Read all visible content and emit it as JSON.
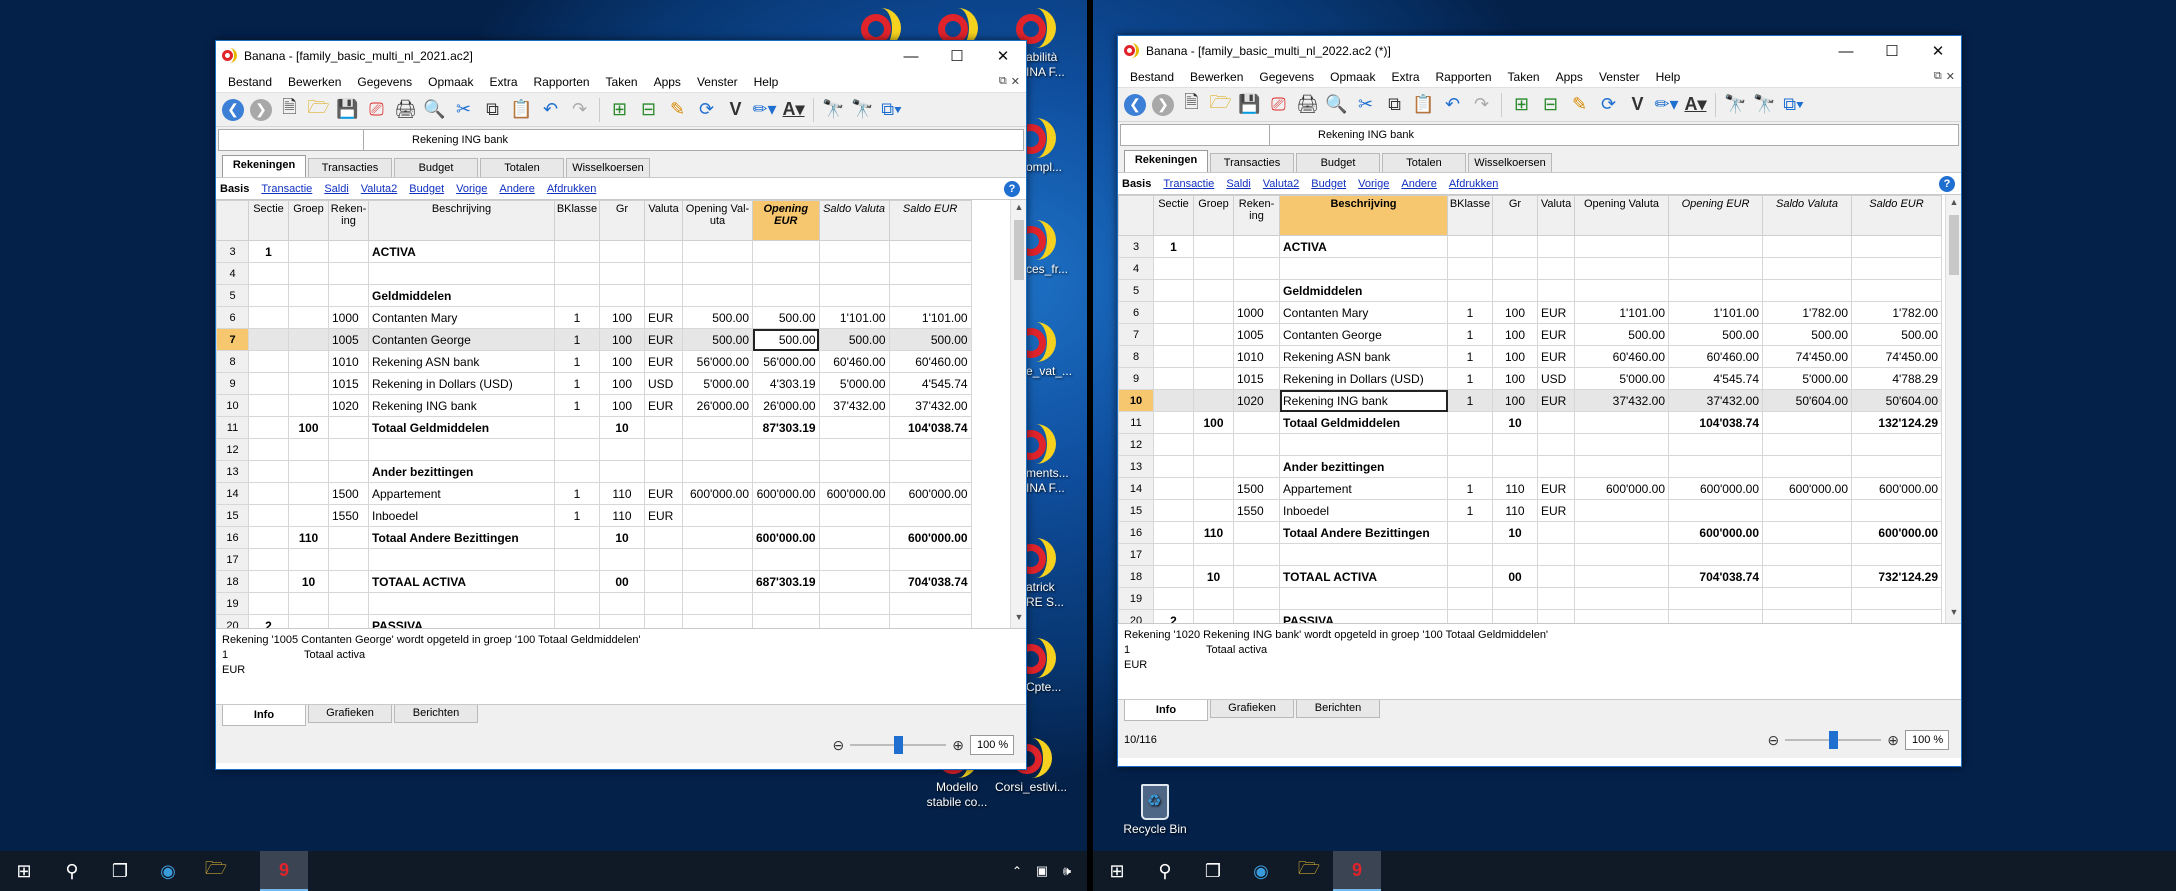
{
  "desktop": {
    "icons_left": [
      {
        "label": "abilità\nINA F...",
        "icon": "banana-icon"
      },
      {
        "label": "ompl...",
        "icon": "banana-icon"
      },
      {
        "label": "ces_fr...",
        "icon": "banana-icon"
      },
      {
        "label": "e_vat_...",
        "icon": "banana-icon"
      },
      {
        "label": "ments...\nINA F...",
        "icon": "banana-icon"
      },
      {
        "label": "atrick\nRE S...",
        "icon": "banana-icon"
      },
      {
        "label": "Cpte...",
        "icon": "banana-icon"
      },
      {
        "label": "Modello\nstabile co...",
        "icon": "banana-icon"
      },
      {
        "label": "Corsi_estivi...",
        "icon": "banana-icon"
      }
    ],
    "recycle_bin": {
      "label": "Recycle Bin",
      "icon": "recycle-bin-icon"
    }
  },
  "taskbar": {
    "icons": [
      "windows-start-icon",
      "search-icon",
      "task-view-icon",
      "edge-browser-icon",
      "file-explorer-icon",
      "banana-app-icon"
    ],
    "tray": [
      "chevron-up-icon",
      "network-icon",
      "volume-icon"
    ]
  },
  "common": {
    "menu": [
      "Bestand",
      "Bewerken",
      "Gegevens",
      "Opmaak",
      "Extra",
      "Rapporten",
      "Taken",
      "Apps",
      "Venster",
      "Help"
    ],
    "tabs": [
      "Rekeningen",
      "Transacties",
      "Budget",
      "Totalen",
      "Wisselkoersen"
    ],
    "subviews": [
      "Basis",
      "Transactie",
      "Saldi",
      "Valuta2",
      "Budget",
      "Vorige",
      "Andere",
      "Afdrukken"
    ],
    "bottom_tabs": [
      "Info",
      "Grafieken",
      "Berichten"
    ],
    "zoom": "100 %",
    "help": "?",
    "columns": [
      "",
      "Sectie",
      "Groep",
      "Rekening",
      "Beschrijving",
      "BKlasse",
      "Gr",
      "Valuta",
      "Opening Valuta",
      "Opening EUR",
      "Saldo Valuta",
      "Saldo EUR"
    ]
  },
  "win1": {
    "title": "Banana - [family_basic_multi_nl_2021.ac2]",
    "cell_value": "Rekening ING bank",
    "columns": [
      "",
      "Sectie",
      "Groep",
      "Reken-\ning",
      "Beschrijving",
      "BKlasse",
      "Gr",
      "Valuta",
      "Opening Val-\nuta",
      "Opening\nEUR",
      "Saldo Valuta",
      "Saldo EUR"
    ],
    "rows": [
      [
        "3",
        "1",
        "",
        "",
        "ACTIVA",
        "",
        "",
        "",
        "",
        "",
        "",
        ""
      ],
      [
        "4",
        "",
        "",
        "",
        "",
        "",
        "",
        "",
        "",
        "",
        "",
        ""
      ],
      [
        "5",
        "",
        "",
        "",
        "Geldmiddelen",
        "",
        "",
        "",
        "",
        "",
        "",
        ""
      ],
      [
        "6",
        "",
        "",
        "1000",
        "Contanten Mary",
        "1",
        "100",
        "EUR",
        "500.00",
        "500.00",
        "1'101.00",
        "1'101.00"
      ],
      [
        "7",
        "",
        "",
        "1005",
        "Contanten George",
        "1",
        "100",
        "EUR",
        "500.00",
        "500.00",
        "500.00",
        "500.00"
      ],
      [
        "8",
        "",
        "",
        "1010",
        "Rekening ASN bank",
        "1",
        "100",
        "EUR",
        "56'000.00",
        "56'000.00",
        "60'460.00",
        "60'460.00"
      ],
      [
        "9",
        "",
        "",
        "1015",
        "Rekening in Dollars (USD)",
        "1",
        "100",
        "USD",
        "5'000.00",
        "4'303.19",
        "5'000.00",
        "4'545.74"
      ],
      [
        "10",
        "",
        "",
        "1020",
        "Rekening ING bank",
        "1",
        "100",
        "EUR",
        "26'000.00",
        "26'000.00",
        "37'432.00",
        "37'432.00"
      ],
      [
        "11",
        "",
        "100",
        "",
        "Totaal Geldmiddelen",
        "",
        "10",
        "",
        "",
        "87'303.19",
        "",
        "104'038.74"
      ],
      [
        "12",
        "",
        "",
        "",
        "",
        "",
        "",
        "",
        "",
        "",
        "",
        ""
      ],
      [
        "13",
        "",
        "",
        "",
        "Ander bezittingen",
        "",
        "",
        "",
        "",
        "",
        "",
        ""
      ],
      [
        "14",
        "",
        "",
        "1500",
        "Appartement",
        "1",
        "110",
        "EUR",
        "600'000.00",
        "600'000.00",
        "600'000.00",
        "600'000.00"
      ],
      [
        "15",
        "",
        "",
        "1550",
        "Inboedel",
        "1",
        "110",
        "EUR",
        "",
        "",
        "",
        ""
      ],
      [
        "16",
        "",
        "110",
        "",
        "Totaal Andere Bezittingen",
        "",
        "10",
        "",
        "",
        "600'000.00",
        "",
        "600'000.00"
      ],
      [
        "17",
        "",
        "",
        "",
        "",
        "",
        "",
        "",
        "",
        "",
        "",
        ""
      ],
      [
        "18",
        "",
        "10",
        "",
        "TOTAAL ACTIVA",
        "",
        "00",
        "",
        "",
        "687'303.19",
        "",
        "704'038.74"
      ],
      [
        "19",
        "",
        "",
        "",
        "",
        "",
        "",
        "",
        "",
        "",
        "",
        ""
      ],
      [
        "20",
        "2",
        "",
        "",
        "PASSIVA",
        "",
        "",
        "",
        "",
        "",
        "",
        ""
      ]
    ],
    "info": {
      "line1": "Rekening '1005 Contanten George' wordt opgeteld in groep '100 Totaal Geldmiddelen'",
      "line2a": "1",
      "line2b": "Totaal activa",
      "line3": "EUR"
    },
    "status": ""
  },
  "win2": {
    "title": "Banana - [family_basic_multi_nl_2022.ac2 (*)]",
    "cell_value": "Rekening ING bank",
    "columns": [
      "",
      "Sectie",
      "Groep",
      "Reken-\ning",
      "Beschrijving",
      "BKlasse",
      "Gr",
      "Valuta",
      "Opening Valuta",
      "Opening EUR",
      "Saldo Valuta",
      "Saldo EUR"
    ],
    "rows": [
      [
        "3",
        "1",
        "",
        "",
        "ACTIVA",
        "",
        "",
        "",
        "",
        "",
        "",
        ""
      ],
      [
        "4",
        "",
        "",
        "",
        "",
        "",
        "",
        "",
        "",
        "",
        "",
        ""
      ],
      [
        "5",
        "",
        "",
        "",
        "Geldmiddelen",
        "",
        "",
        "",
        "",
        "",
        "",
        ""
      ],
      [
        "6",
        "",
        "",
        "1000",
        "Contanten Mary",
        "1",
        "100",
        "EUR",
        "1'101.00",
        "1'101.00",
        "1'782.00",
        "1'782.00"
      ],
      [
        "7",
        "",
        "",
        "1005",
        "Contanten George",
        "1",
        "100",
        "EUR",
        "500.00",
        "500.00",
        "500.00",
        "500.00"
      ],
      [
        "8",
        "",
        "",
        "1010",
        "Rekening ASN bank",
        "1",
        "100",
        "EUR",
        "60'460.00",
        "60'460.00",
        "74'450.00",
        "74'450.00"
      ],
      [
        "9",
        "",
        "",
        "1015",
        "Rekening in Dollars (USD)",
        "1",
        "100",
        "USD",
        "5'000.00",
        "4'545.74",
        "5'000.00",
        "4'788.29"
      ],
      [
        "10",
        "",
        "",
        "1020",
        "Rekening ING bank",
        "1",
        "100",
        "EUR",
        "37'432.00",
        "37'432.00",
        "50'604.00",
        "50'604.00"
      ],
      [
        "11",
        "",
        "100",
        "",
        "Totaal Geldmiddelen",
        "",
        "10",
        "",
        "",
        "104'038.74",
        "",
        "132'124.29"
      ],
      [
        "12",
        "",
        "",
        "",
        "",
        "",
        "",
        "",
        "",
        "",
        "",
        ""
      ],
      [
        "13",
        "",
        "",
        "",
        "Ander bezittingen",
        "",
        "",
        "",
        "",
        "",
        "",
        ""
      ],
      [
        "14",
        "",
        "",
        "1500",
        "Appartement",
        "1",
        "110",
        "EUR",
        "600'000.00",
        "600'000.00",
        "600'000.00",
        "600'000.00"
      ],
      [
        "15",
        "",
        "",
        "1550",
        "Inboedel",
        "1",
        "110",
        "EUR",
        "",
        "",
        "",
        ""
      ],
      [
        "16",
        "",
        "110",
        "",
        "Totaal Andere Bezittingen",
        "",
        "10",
        "",
        "",
        "600'000.00",
        "",
        "600'000.00"
      ],
      [
        "17",
        "",
        "",
        "",
        "",
        "",
        "",
        "",
        "",
        "",
        "",
        ""
      ],
      [
        "18",
        "",
        "10",
        "",
        "TOTAAL ACTIVA",
        "",
        "00",
        "",
        "",
        "704'038.74",
        "",
        "732'124.29"
      ],
      [
        "19",
        "",
        "",
        "",
        "",
        "",
        "",
        "",
        "",
        "",
        "",
        ""
      ],
      [
        "20",
        "2",
        "",
        "",
        "PASSIVA",
        "",
        "",
        "",
        "",
        "",
        "",
        ""
      ]
    ],
    "info": {
      "line1": "Rekening '1020 Rekening ING bank' wordt opgeteld in groep '100 Totaal Geldmiddelen'",
      "line2a": "1",
      "line2b": "Totaal activa",
      "line3": "EUR"
    },
    "status": "10/116"
  }
}
